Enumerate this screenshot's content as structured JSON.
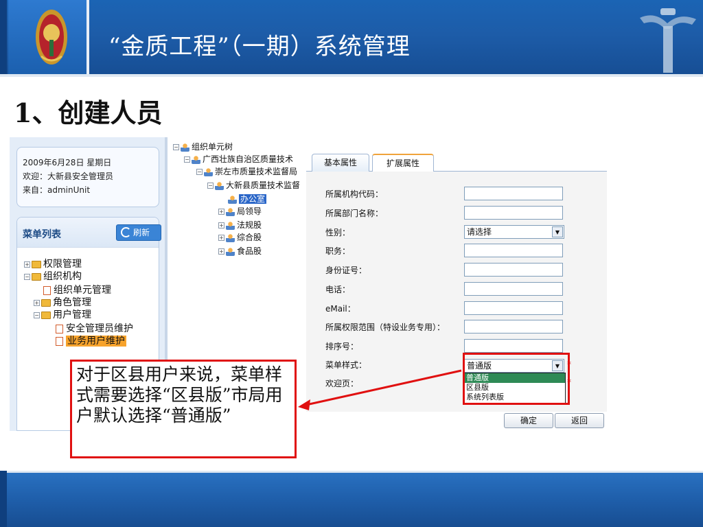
{
  "header": {
    "title": "“金质工程”（一期）系统管理",
    "emblem_icon": "national-emblem-icon",
    "pillar_icon": "huabiao-pillar-icon",
    "banner_color": "#1d5ca8"
  },
  "slide": {
    "heading": "1、创建人员"
  },
  "info": {
    "date": "2009年6月28日 星期日",
    "welcome": "欢迎：大新县安全管理员",
    "from": "来自：adminUnit"
  },
  "menu": {
    "title": "菜单列表",
    "refresh_label": "刷新",
    "items": [
      {
        "label": "权限管理"
      },
      {
        "label": "组织机构"
      },
      {
        "label": "组织单元管理"
      },
      {
        "label": "角色管理"
      },
      {
        "label": "用户管理"
      },
      {
        "label": "安全管理员维护"
      },
      {
        "label": "业务用户维护"
      }
    ]
  },
  "org_tree": {
    "items": [
      {
        "label": "组织单元树"
      },
      {
        "label": "广西壮族自治区质量技术"
      },
      {
        "label": "崇左市质量技术监督局"
      },
      {
        "label": "大新县质量技术监督"
      },
      {
        "label": "办公室"
      },
      {
        "label": "局领导"
      },
      {
        "label": "法规股"
      },
      {
        "label": "综合股"
      },
      {
        "label": "食品股"
      }
    ]
  },
  "tabs": [
    {
      "label": "基本属性"
    },
    {
      "label": "扩展属性"
    }
  ],
  "form": {
    "fields": [
      {
        "label": "所属机构代码："
      },
      {
        "label": "所属部门名称："
      },
      {
        "label": "性别："
      },
      {
        "label": "职务："
      },
      {
        "label": "身份证号："
      },
      {
        "label": "电话："
      },
      {
        "label": "eMail："
      },
      {
        "label": "所属权限范围（特设业务专用）："
      },
      {
        "label": "排序号："
      },
      {
        "label": "菜单样式："
      },
      {
        "label": "欢迎页："
      }
    ],
    "gender_value": "请选择",
    "menu_style_value": "普通版",
    "menu_style_options": [
      "普通版",
      "区县版",
      "系统列表版"
    ],
    "required_mark": "*",
    "ok_label": "确定",
    "back_label": "返回"
  },
  "callout": {
    "text": "对于区县用户来说，菜单样式需要选择“区县版”市局用户默认选择“普通版”",
    "border_color": "#e01010"
  }
}
